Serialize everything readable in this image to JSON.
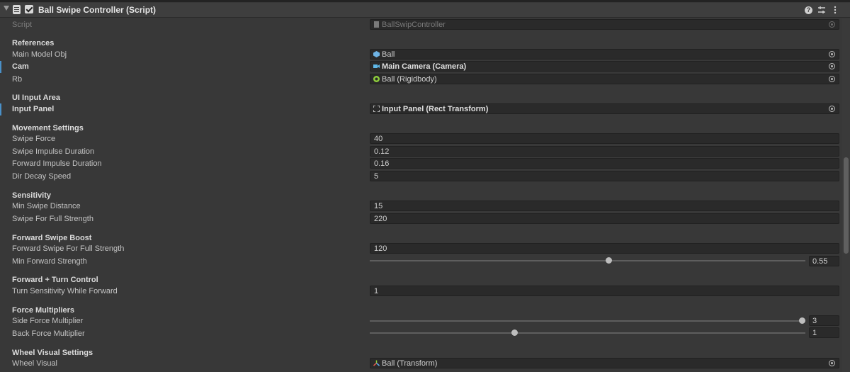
{
  "component": {
    "title": "Ball Swipe Controller (Script)",
    "help_icon": "help-icon",
    "preset_icon": "preset-icon",
    "menu_icon": "kebab-menu-icon"
  },
  "script_field": {
    "label": "Script",
    "value": "BallSwipController"
  },
  "sections": {
    "references": "References",
    "ui_input_area": "UI Input Area",
    "movement_settings": "Movement Settings",
    "sensitivity": "Sensitivity",
    "forward_swipe_boost": "Forward Swipe Boost",
    "forward_turn_control": "Forward + Turn Control",
    "force_multipliers": "Force Multipliers",
    "wheel_visual_settings": "Wheel Visual Settings"
  },
  "fields": {
    "main_model_obj": {
      "label": "Main Model Obj",
      "value": "Ball"
    },
    "cam": {
      "label": "Cam",
      "value": "Main Camera (Camera)"
    },
    "rb": {
      "label": "Rb",
      "value": "Ball (Rigidbody)"
    },
    "input_panel": {
      "label": "Input Panel",
      "value": "Input Panel (Rect Transform)"
    },
    "swipe_force": {
      "label": "Swipe Force",
      "value": "40"
    },
    "swipe_impulse_duration": {
      "label": "Swipe Impulse Duration",
      "value": "0.12"
    },
    "forward_impulse_duration": {
      "label": "Forward Impulse Duration",
      "value": "0.16"
    },
    "dir_decay_speed": {
      "label": "Dir Decay Speed",
      "value": "5"
    },
    "min_swipe_distance": {
      "label": "Min Swipe Distance",
      "value": "15"
    },
    "swipe_for_full_strength": {
      "label": "Swipe For Full Strength",
      "value": "220"
    },
    "forward_swipe_for_full_strength": {
      "label": "Forward Swipe For Full Strength",
      "value": "120"
    },
    "min_forward_strength": {
      "label": "Min Forward Strength",
      "value": "0.55",
      "fraction": 0.55
    },
    "turn_sensitivity_while_forward": {
      "label": "Turn Sensitivity While Forward",
      "value": "1"
    },
    "side_force_multiplier": {
      "label": "Side Force Multiplier",
      "value": "3",
      "fraction": 1.0
    },
    "back_force_multiplier": {
      "label": "Back Force Multiplier",
      "value": "1",
      "fraction": 0.33
    },
    "wheel_visual": {
      "label": "Wheel Visual",
      "value": "Ball (Transform)"
    }
  },
  "colors": {
    "background": "#383838",
    "field": "#2a2a2a",
    "selection_marker": "#4a90c8",
    "rigidbody_icon": "#8fcf3c",
    "model_icon": "#6fb4e6",
    "camera_icon": "#5fb8e8"
  }
}
